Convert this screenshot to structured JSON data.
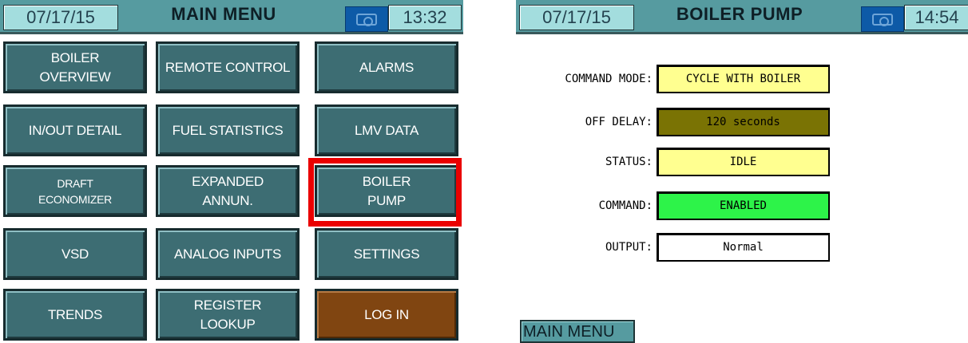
{
  "left_screen": {
    "date": "07/17/15",
    "title": "MAIN MENU",
    "time": "13:32",
    "buttons": [
      {
        "label": "BOILER\nOVERVIEW"
      },
      {
        "label": "REMOTE CONTROL"
      },
      {
        "label": "ALARMS"
      },
      {
        "label": "IN/OUT DETAIL"
      },
      {
        "label": "FUEL STATISTICS"
      },
      {
        "label": "LMV DATA"
      },
      {
        "label": "DRAFT\nECONOMIZER"
      },
      {
        "label": "EXPANDED\nANNUN."
      },
      {
        "label": "BOILER\nPUMP"
      },
      {
        "label": "VSD"
      },
      {
        "label": "ANALOG INPUTS"
      },
      {
        "label": "SETTINGS"
      },
      {
        "label": "TRENDS"
      },
      {
        "label": "REGISTER\nLOOKUP"
      },
      {
        "label": "LOG IN"
      }
    ],
    "highlighted_button": "BOILER PUMP",
    "highlight_color": "#ea0000"
  },
  "right_screen": {
    "date": "07/17/15",
    "title": "BOILER PUMP",
    "time": "14:54",
    "fields": [
      {
        "label": "COMMAND MODE:",
        "value": "CYCLE WITH BOILER",
        "color": "#ffff90"
      },
      {
        "label": "OFF DELAY:",
        "value": "120 seconds",
        "color": "#7a7304"
      },
      {
        "label": "STATUS:",
        "value": "IDLE",
        "color": "#ffff90"
      },
      {
        "label": "COMMAND:",
        "value": "ENABLED",
        "color": "#2df349"
      },
      {
        "label": "OUTPUT:",
        "value": "Normal",
        "color": "#ffffff"
      }
    ],
    "main_menu_label": "MAIN MENU"
  },
  "icons": {
    "camera": "camera-icon"
  },
  "colors": {
    "header_bg": "#569ba0",
    "button_bg": "#3d6d73",
    "login_bg": "#804511"
  }
}
